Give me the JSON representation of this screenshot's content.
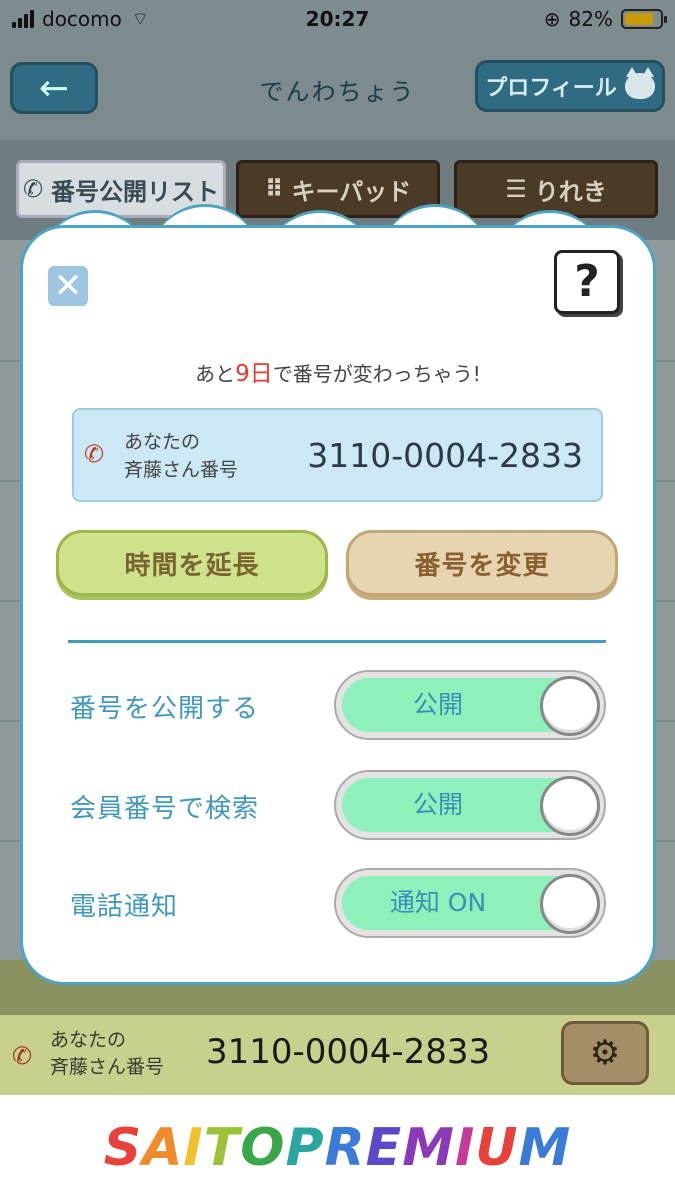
{
  "status_bar": {
    "carrier": "docomo",
    "time": "20:27",
    "battery_pct": "82%",
    "battery_level": 0.82
  },
  "header": {
    "back_label": "←",
    "title": "でんわちょう",
    "profile_label": "プロフィール"
  },
  "tabs": [
    {
      "label": "番号公開リスト",
      "icon": "phone-icon"
    },
    {
      "label": "キーパッド",
      "icon": "keypad-icon"
    },
    {
      "label": "りれき",
      "icon": "list-icon"
    }
  ],
  "modal": {
    "close_label": "✕",
    "help_label": "?",
    "notice_prefix": "あと",
    "notice_days": "9日",
    "notice_suffix": "で番号が変わっちゃう!",
    "number_label_line1": "あなたの",
    "number_label_line2": "斉藤さん番号",
    "number": "3110-0004-2833",
    "extend_button": "時間を延長",
    "change_button": "番号を変更",
    "settings": [
      {
        "label": "番号を公開する",
        "value": "公開",
        "on": true
      },
      {
        "label": "会員番号で検索",
        "value": "公開",
        "on": true
      },
      {
        "label": "電話通知",
        "value": "通知 ON",
        "on": true
      }
    ]
  },
  "bottom_bar": {
    "label_line1": "あなたの",
    "label_line2": "斉藤さん番号",
    "number": "3110-0004-2833"
  },
  "footer": {
    "logo_text": "SAITOPREMIUM"
  },
  "colors": {
    "accent": "#3f97c2",
    "alert": "#e53a2f",
    "toggle_on": "#8ef0ba"
  }
}
